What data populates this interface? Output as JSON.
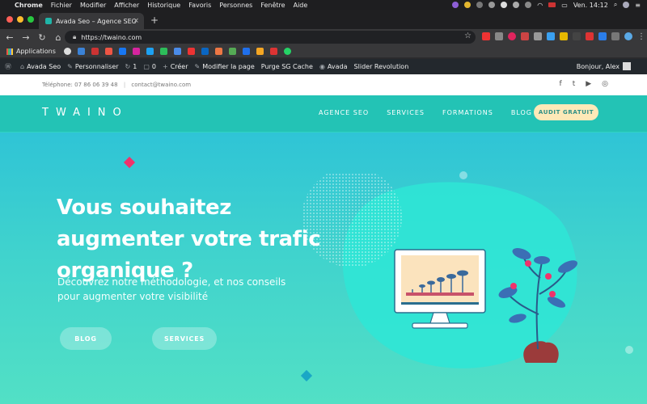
{
  "mac_menu": {
    "app": "Chrome",
    "items": [
      "Fichier",
      "Modifier",
      "Afficher",
      "Historique",
      "Favoris",
      "Personnes",
      "Fenêtre",
      "Aide"
    ],
    "clock": "Ven. 14:12"
  },
  "browser": {
    "tab_title": "Avada Seo – Agence SEO",
    "url": "https://twaino.com",
    "bookmarks_label": "Applications"
  },
  "wp_admin": {
    "site": "Avada Seo",
    "customize": "Personnaliser",
    "updates": "1",
    "comments": "0",
    "create": "Créer",
    "edit_page": "Modifier la page",
    "purge": "Purge SG Cache",
    "avada": "Avada",
    "slider": "Slider Revolution",
    "greeting": "Bonjour, Alex"
  },
  "site": {
    "phone": "Téléphone: 07 86 06 39 48",
    "email": "contact@twaino.com",
    "logo": "TWAINO",
    "nav": [
      "AGENCE SEO",
      "SERVICES",
      "FORMATIONS",
      "BLOG"
    ],
    "cta": "AUDIT GRATUIT"
  },
  "hero": {
    "title": "Vous souhaitez augmenter votre trafic organique ?",
    "subtitle": "Découvrez notre méthodologie, et nos conseils pour augmenter votre visibilité",
    "btn_blog": "BLOG",
    "btn_services": "SERVICES"
  },
  "colors": {
    "teal": "#23c3b5",
    "cta_bg": "#fde9b8",
    "pink": "#f0336b"
  }
}
